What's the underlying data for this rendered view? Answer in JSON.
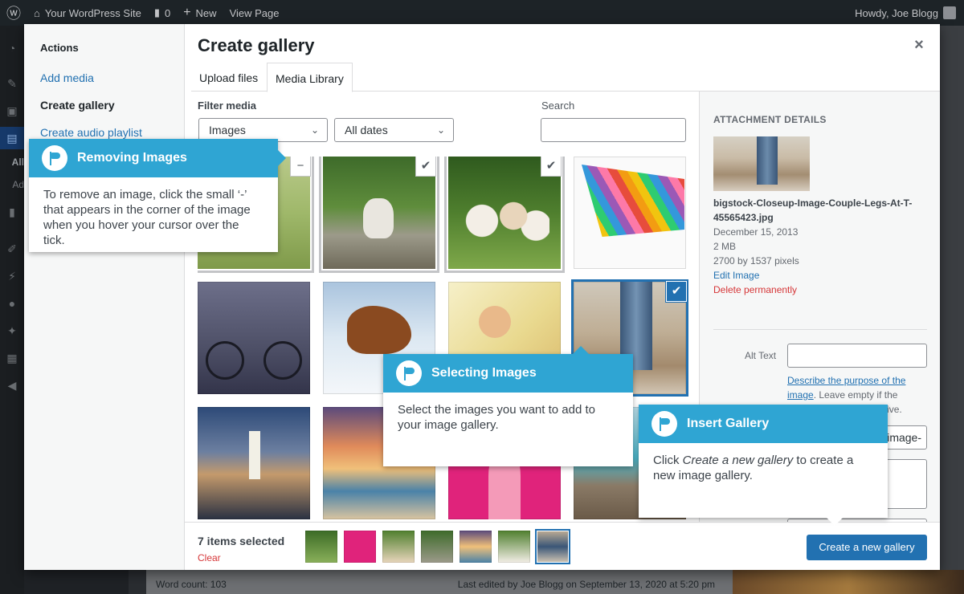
{
  "admin_bar": {
    "site_name": "Your WordPress Site",
    "comments_count": "0",
    "new_label": "New",
    "view_page_label": "View Page",
    "howdy": "Howdy, Joe Blogg"
  },
  "admin_menu": {
    "all_label": "All",
    "add_label": "Ad"
  },
  "background": {
    "word_count": "Word count: 103",
    "last_edited": "Last edited by Joe Blogg on September 13, 2020 at 5:20 pm"
  },
  "modal": {
    "title": "Create gallery",
    "close_glyph": "×",
    "sidebar": {
      "heading": "Actions",
      "items": [
        {
          "label": "Add media"
        },
        {
          "label": "Create gallery"
        },
        {
          "label": "Create audio playlist"
        }
      ]
    },
    "tabs": [
      {
        "label": "Upload files"
      },
      {
        "label": "Media Library"
      }
    ],
    "filter": {
      "label": "Filter media",
      "type_value": "Images",
      "date_value": "All dates",
      "search_label": "Search",
      "search_value": ""
    },
    "grid": {
      "items": [
        {
          "name": "grass",
          "state": "remove"
        },
        {
          "name": "kitten",
          "state": "selected"
        },
        {
          "name": "puppies",
          "state": "selected"
        },
        {
          "name": "pencils",
          "state": "none"
        },
        {
          "name": "bicycle",
          "state": "none"
        },
        {
          "name": "horse",
          "state": "none"
        },
        {
          "name": "girl-headphones",
          "state": "none"
        },
        {
          "name": "beach-legs",
          "state": "current"
        },
        {
          "name": "lighthouse",
          "state": "none"
        },
        {
          "name": "sunset-beach",
          "state": "none"
        },
        {
          "name": "pink-woman",
          "state": "none"
        },
        {
          "name": "boardwalk",
          "state": "none"
        }
      ]
    },
    "attachment": {
      "heading": "ATTACHMENT DETAILS",
      "filename": "bigstock-Closeup-Image-Couple-Legs-At-T-45565423.jpg",
      "date": "December 15, 2013",
      "size": "2 MB",
      "dimensions": "2700 by 1537 pixels",
      "edit_link": "Edit Image",
      "delete_link": "Delete permanently",
      "alt_label": "Alt Text",
      "alt_value": "",
      "alt_help_link": "Describe the purpose of the image",
      "alt_help_rest": ". Leave empty if the image is purely decorative.",
      "title_value_fragment": "image-"
    },
    "toolbar": {
      "selected_count": "7 items selected",
      "clear_label": "Clear",
      "create_button": "Create a new gallery",
      "selection": [
        "puppies",
        "pink-woman",
        "puppies-2",
        "kitten",
        "sunset-beach",
        "bulldog",
        "beach-legs"
      ]
    }
  },
  "callouts": {
    "removing": {
      "title": "Removing Images",
      "body": "To remove an image, click the small ‘-’ that appears in the corner of the image when you hover your cursor over the tick."
    },
    "selecting": {
      "title": "Selecting Images",
      "body": "Select the images you want to add to your image gallery."
    },
    "insert": {
      "title": "Insert Gallery",
      "body_pre": "Click ",
      "body_em": "Create a new gallery",
      "body_post": " to create a new image gallery."
    }
  },
  "colors": {
    "accent": "#2271b1",
    "callout": "#2fa5d3",
    "danger": "#d63638"
  }
}
